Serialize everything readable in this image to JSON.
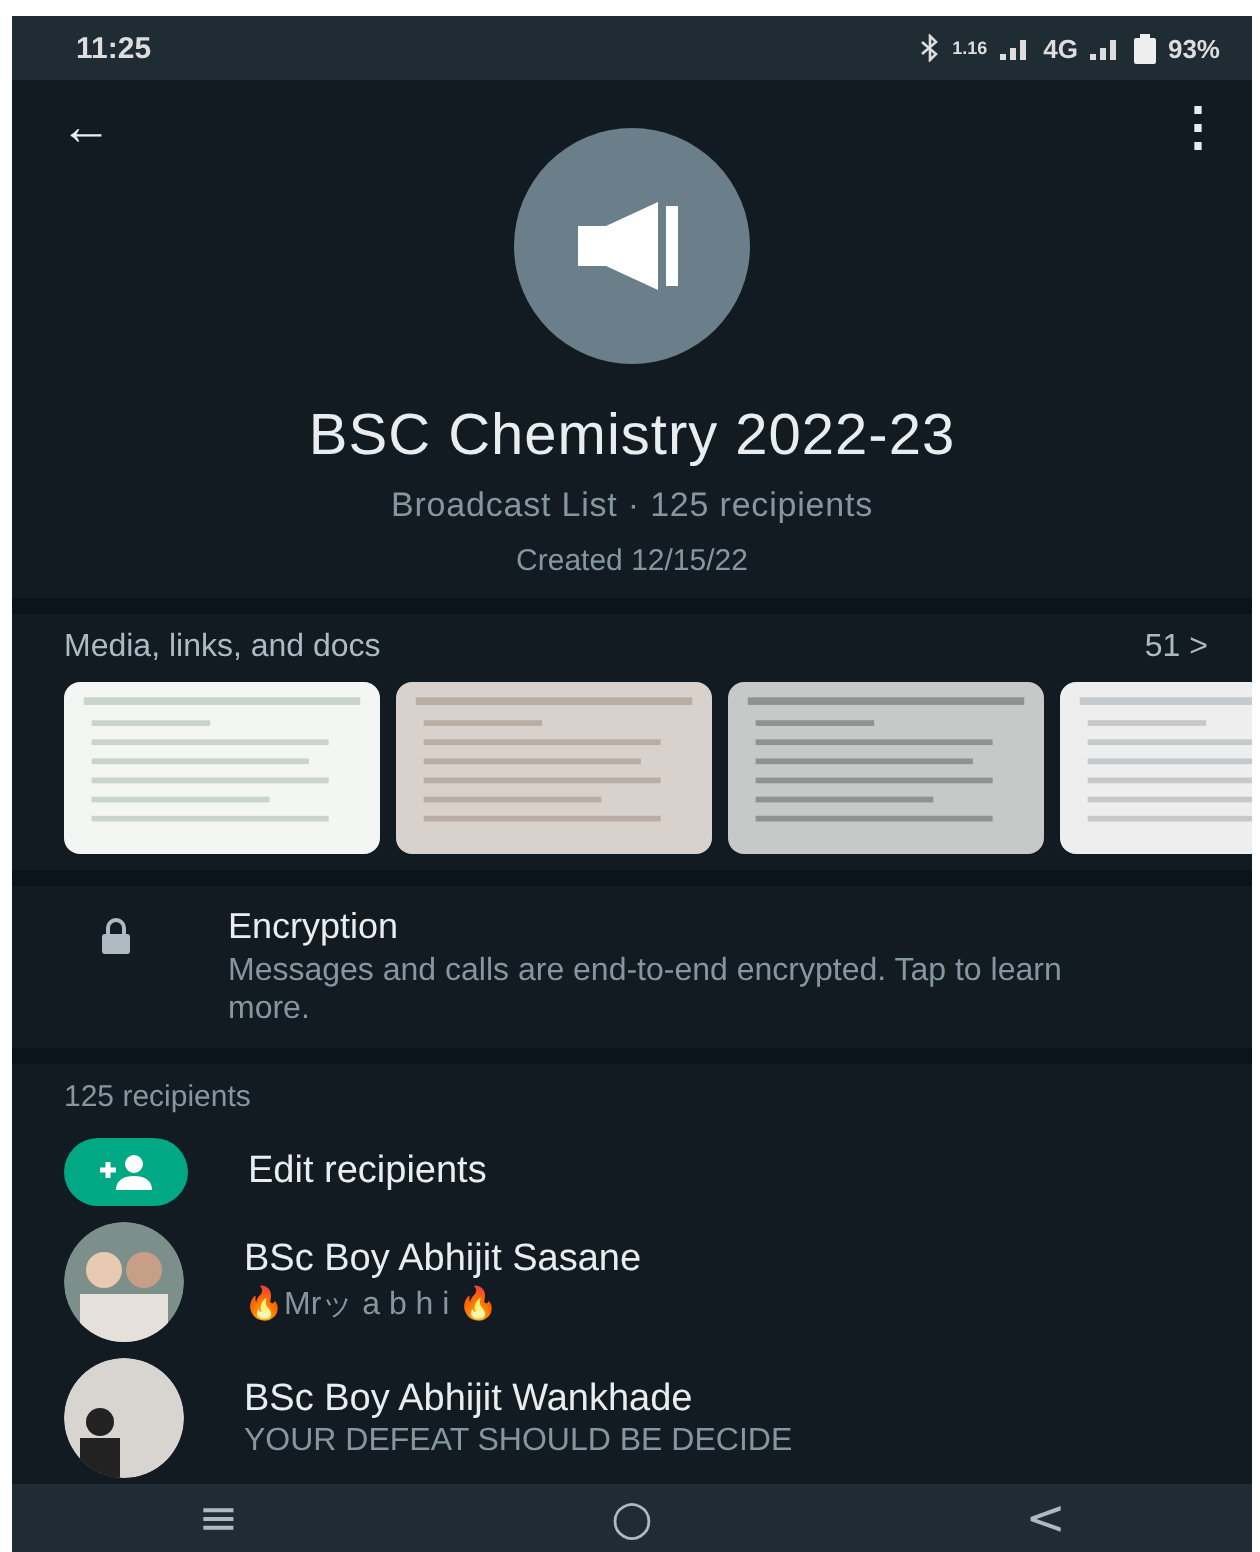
{
  "status_bar": {
    "time": "11:25",
    "network": "4G",
    "battery": "93%",
    "speed": "1.16"
  },
  "header": {
    "back": "←",
    "menu": "⋮",
    "title": "BSC Chemistry 2022-23",
    "subtitle": "Broadcast List · 125 recipients",
    "created": "Created 12/15/22"
  },
  "media": {
    "title": "Media, links, and docs",
    "count": "51 >"
  },
  "encryption": {
    "title": "Encryption",
    "text": "Messages and calls are end-to-end encrypted. Tap to learn more."
  },
  "recipients": {
    "header": "125 recipients",
    "edit": "Edit recipients",
    "items": [
      {
        "name": "BSc Boy Abhijit Sasane",
        "status": "🔥Mrッ a b h i 🔥"
      },
      {
        "name": "BSc Boy Abhijit Wankhade",
        "status": "YOUR DEFEAT SHOULD BE DECIDE"
      }
    ]
  },
  "nav": {
    "recents": "≡",
    "home": "○",
    "back": "<"
  }
}
